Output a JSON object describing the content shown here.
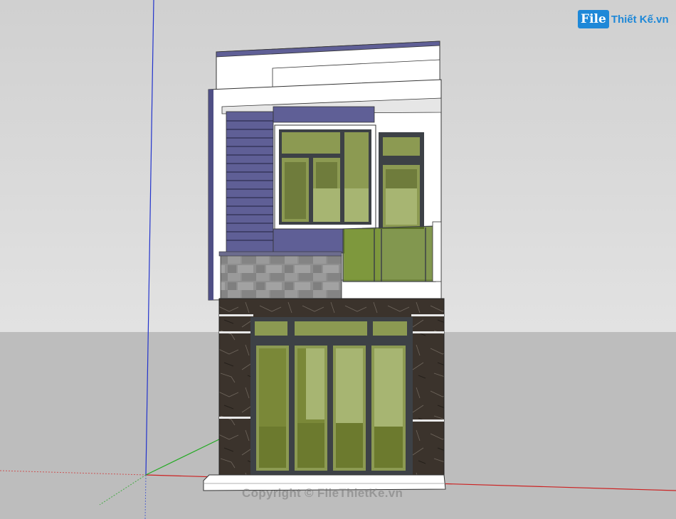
{
  "app": {
    "type": "3D modeling viewport"
  },
  "viewport": {
    "sky_color": "#d8d8d8",
    "ground_color": "#bdbdbd",
    "axis_colors": {
      "blue": "#2233cc",
      "red": "#cc2222",
      "green": "#22aa22"
    }
  },
  "branding": {
    "logo_prefix": "File",
    "logo_rest": "Thiết Kế.vn",
    "watermark": "Copyright © FileThietKe.vn"
  },
  "model": {
    "description_icon": "two-storey-townhouse-model",
    "colors": {
      "wall_white": "#ffffff",
      "accent_purple": "#5f5f96",
      "marble_dark": "#3b332c",
      "stone_gray": "#8e8e8e",
      "glass_green": "#8c9a52",
      "frame_dark": "#3d4146"
    }
  }
}
